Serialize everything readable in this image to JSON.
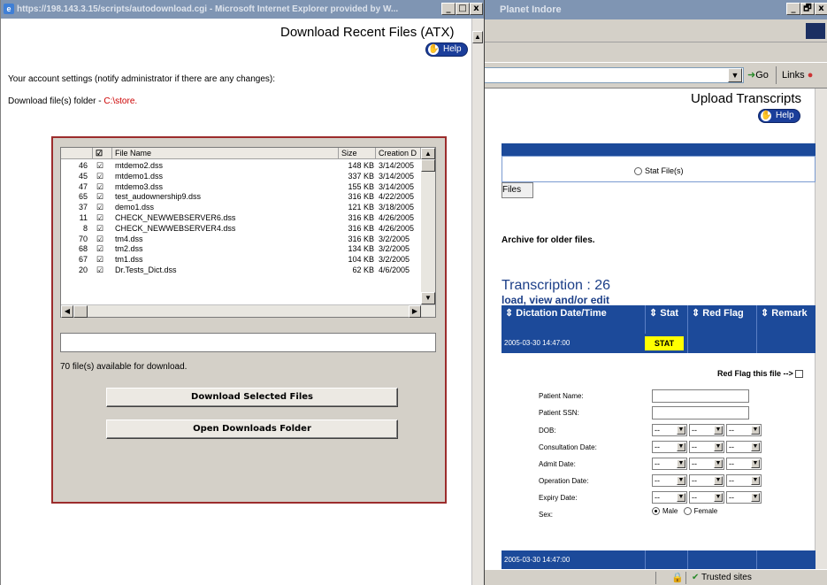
{
  "front_window": {
    "title": "https://198.143.3.15/scripts/autodownload.cgi - Microsoft Internet Explorer provided by W...",
    "controls": {
      "minimize": "_",
      "maximize": "□",
      "close": "x"
    },
    "page_title": "Download Recent Files (ATX)",
    "help_label": "Help",
    "account_note": "Your account settings (notify administrator if there are any changes):",
    "download_folder_label": "Download file(s) folder - ",
    "download_folder_path": "C:\\store.",
    "list": {
      "headers": [
        "",
        "☑",
        "File Name",
        "Size",
        "Creation D"
      ],
      "rows": [
        {
          "id": "46",
          "checked": "☑",
          "name": "mtdemo2.dss",
          "size": "148 KB",
          "date": "3/14/2005"
        },
        {
          "id": "45",
          "checked": "☑",
          "name": "mtdemo1.dss",
          "size": "337 KB",
          "date": "3/14/2005"
        },
        {
          "id": "47",
          "checked": "☑",
          "name": "mtdemo3.dss",
          "size": "155 KB",
          "date": "3/14/2005"
        },
        {
          "id": "65",
          "checked": "☑",
          "name": "test_audownership9.dss",
          "size": "316 KB",
          "date": "4/22/2005"
        },
        {
          "id": "37",
          "checked": "☑",
          "name": "demo1.dss",
          "size": "121 KB",
          "date": "3/18/2005"
        },
        {
          "id": "11",
          "checked": "☑",
          "name": "CHECK_NEWWEBSERVER6.dss",
          "size": "316 KB",
          "date": "4/26/2005"
        },
        {
          "id": "8",
          "checked": "☑",
          "name": "CHECK_NEWWEBSERVER4.dss",
          "size": "316 KB",
          "date": "4/26/2005"
        },
        {
          "id": "70",
          "checked": "☑",
          "name": "tm4.dss",
          "size": "316 KB",
          "date": "3/2/2005"
        },
        {
          "id": "68",
          "checked": "☑",
          "name": "tm2.dss",
          "size": "134 KB",
          "date": "3/2/2005"
        },
        {
          "id": "67",
          "checked": "☑",
          "name": "tm1.dss",
          "size": "104 KB",
          "date": "3/2/2005"
        },
        {
          "id": "20",
          "checked": "☑",
          "name": "Dr.Tests_Dict.dss",
          "size": "62 KB",
          "date": "4/6/2005"
        }
      ]
    },
    "available_text": "70 file(s) available for download.",
    "download_button": "Download Selected Files",
    "open_folder_button": "Open Downloads Folder"
  },
  "back_window": {
    "title": "Planet Indore",
    "controls": {
      "minimize": "_",
      "maximize": "🗗",
      "close": "x"
    },
    "go_label": "Go",
    "links_label": "Links",
    "page_title": "Upload Transcripts",
    "help_label": "Help",
    "stat_file_label": "Stat File(s)",
    "files_tab": "Files",
    "archive_text": "Archive for older files.",
    "transcription_title": "Transcription : 26",
    "transcription_sub": "load, view and/or edit",
    "table_headers": [
      "Dictation Date/Time",
      "Stat",
      "Red Flag",
      "Remark"
    ],
    "row1": {
      "date": "2005-03-30 14:47:00",
      "stat": "STAT"
    },
    "row2": {
      "date": "2005-03-30 14:47:00"
    },
    "red_flag_label": "Red Flag this file -->",
    "form": {
      "patient_name": "Patient Name:",
      "patient_ssn": "Patient SSN:",
      "dob": "DOB:",
      "consultation_date": "Consultation Date:",
      "admit_date": "Admit Date:",
      "operation_date": "Operation Date:",
      "expiry_date": "Expiry Date:",
      "sex": "Sex:",
      "select_placeholder": "--",
      "male": "Male",
      "female": "Female"
    },
    "status_trusted": "Trusted sites"
  },
  "colors": {
    "title_bar": "#7f95b3",
    "table_blue": "#1c4a9a",
    "stat_yellow": "#ffff00",
    "panel_border": "#9c2c2c",
    "path_red": "#cc0000"
  }
}
